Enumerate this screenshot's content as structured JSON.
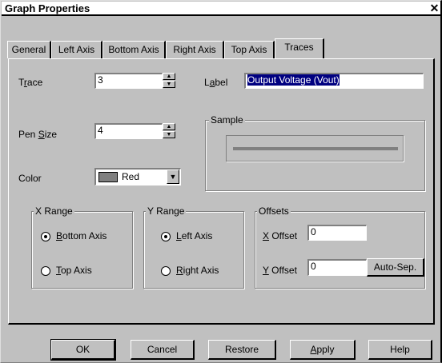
{
  "window": {
    "title": "Graph Properties",
    "close_glyph": "✕"
  },
  "tabs": [
    {
      "label": "General"
    },
    {
      "label": "Left Axis"
    },
    {
      "label": "Bottom Axis"
    },
    {
      "label": "Right Axis"
    },
    {
      "label": "Top Axis"
    },
    {
      "label": "Traces",
      "active": true
    }
  ],
  "trace": {
    "label": "Trace",
    "value": "3"
  },
  "pen_size": {
    "label": "Pen Size",
    "value": "4"
  },
  "color": {
    "label": "Color",
    "value": "Red",
    "swatch": "#808080"
  },
  "trace_label": {
    "label": "Label",
    "value": "Output Voltage (Vout)"
  },
  "sample": {
    "legend": "Sample",
    "line_color": "#808080"
  },
  "x_range": {
    "legend": "X Range",
    "options": [
      "Bottom Axis",
      "Top Axis"
    ],
    "selected": "Bottom Axis"
  },
  "y_range": {
    "legend": "Y Range",
    "options": [
      "Left Axis",
      "Right Axis"
    ],
    "selected": "Left Axis"
  },
  "offsets": {
    "legend": "Offsets",
    "x_label": "X Offset",
    "x_value": "0",
    "y_label": "Y Offset",
    "y_value": "0",
    "auto_sep": "Auto-Sep."
  },
  "buttons": {
    "ok": "OK",
    "cancel": "Cancel",
    "restore": "Restore",
    "apply": "Apply",
    "help": "Help"
  }
}
